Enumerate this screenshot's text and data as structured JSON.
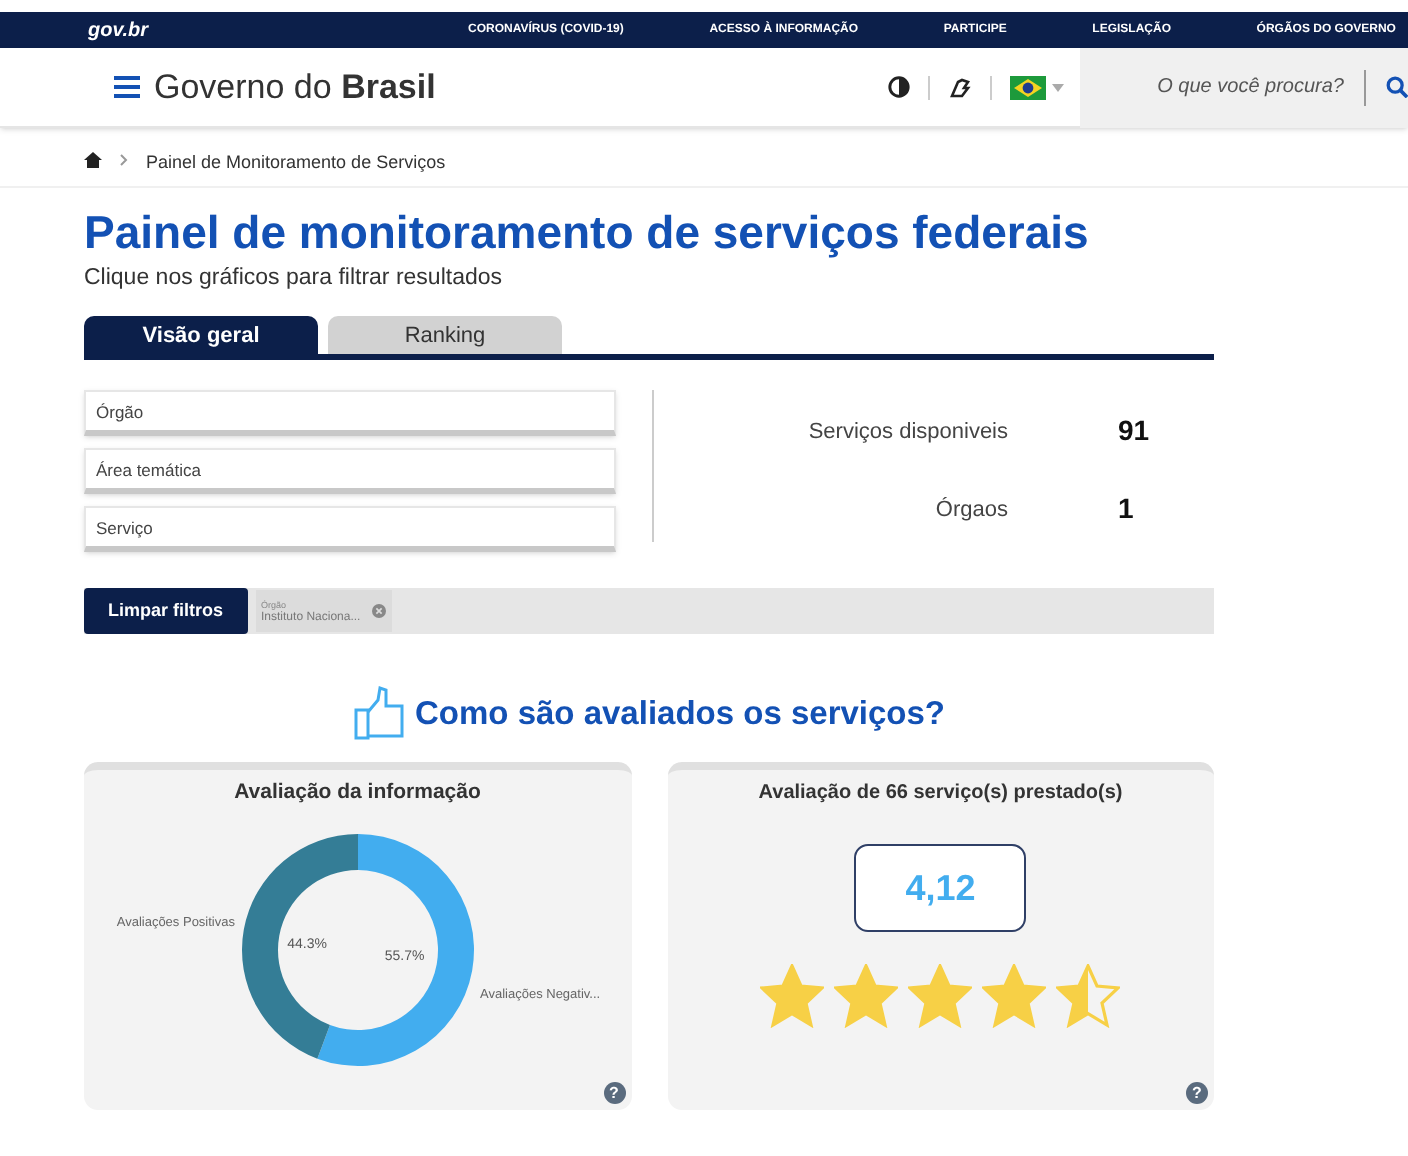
{
  "top_bar": {
    "logo": "gov.br",
    "links": [
      "CORONAVÍRUS (COVID-19)",
      "ACESSO À INFORMAÇÃO",
      "PARTICIPE",
      "LEGISLAÇÃO",
      "ÓRGÃOS DO GOVERNO"
    ]
  },
  "header": {
    "site_name_regular": "Governo do",
    "site_name_bold": "Brasil",
    "search": {
      "placeholder": "O que você procura?"
    }
  },
  "breadcrumb": [
    "Painel de Monitoramento de Serviços"
  ],
  "title": "Painel de monitoramento de serviços federais",
  "subtitle": "Clique nos gráficos para filtrar resultados",
  "tabs": [
    {
      "label": "Visão geral",
      "selected": true
    },
    {
      "label": "Ranking",
      "selected": false
    }
  ],
  "filters": [
    {
      "placeholder": "Órgão"
    },
    {
      "placeholder": "Área temática"
    },
    {
      "placeholder": "Serviço"
    }
  ],
  "stats": [
    {
      "label": "Serviços disponiveis",
      "value": "91"
    },
    {
      "label": "Órgaos",
      "value": "1"
    }
  ],
  "clear_button": "Limpar filtros",
  "active_filters": [
    {
      "field": "Órgão",
      "value": "Instituto Naciona..."
    }
  ],
  "section_heading": "Como são avaliados os serviços?",
  "info_card": {
    "title": "Avaliação da informação",
    "help": "?",
    "chart_data": {
      "type": "donut",
      "categories": [
        "Avaliações Positivas",
        "Avaliações Negativ..."
      ],
      "values": [
        44.3,
        55.7
      ],
      "colors": [
        "#347d96",
        "#42adef"
      ],
      "value_labels": [
        "44.3%",
        "55.7%"
      ]
    }
  },
  "rating_card": {
    "title": "Avaliação de 66 serviço(s) prestado(s)",
    "score": "4,12",
    "stars": 4.5,
    "help": "?"
  }
}
